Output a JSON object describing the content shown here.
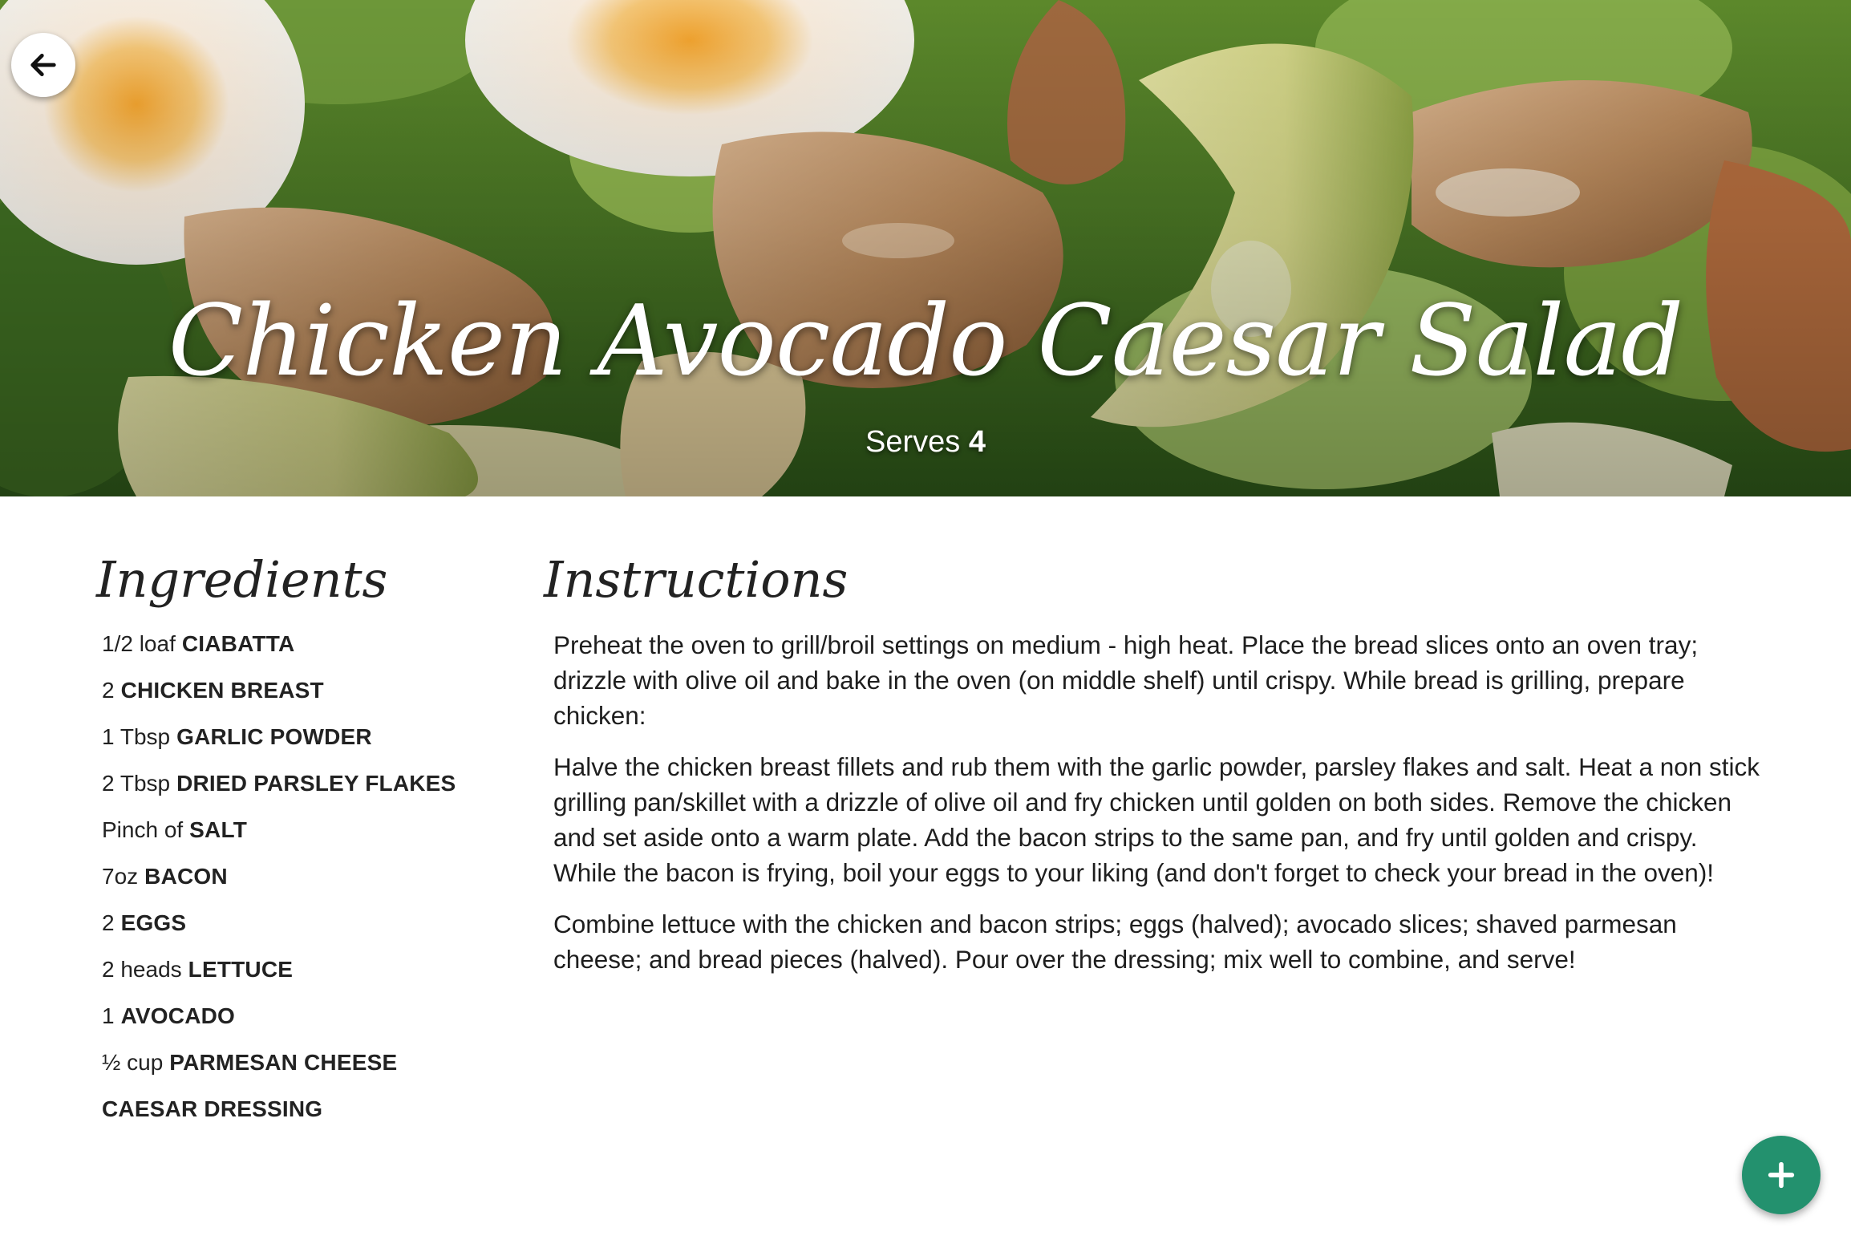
{
  "hero": {
    "title": "Chicken Avocado Caesar Salad",
    "serves_label": "Serves",
    "serves_count": "4",
    "back_icon": "arrow-left-icon"
  },
  "ingredients": {
    "heading": "Ingredients",
    "items": [
      {
        "qty": "1/2 loaf",
        "name": "CIABATTA"
      },
      {
        "qty": "2",
        "name": "CHICKEN BREAST"
      },
      {
        "qty": "1 Tbsp",
        "name": "GARLIC POWDER"
      },
      {
        "qty": "2 Tbsp",
        "name": "DRIED PARSLEY FLAKES"
      },
      {
        "qty": "Pinch of",
        "name": "SALT"
      },
      {
        "qty": "7oz",
        "name": "BACON"
      },
      {
        "qty": "2",
        "name": "EGGS"
      },
      {
        "qty": "2 heads",
        "name": "LETTUCE"
      },
      {
        "qty": "1",
        "name": "AVOCADO"
      },
      {
        "qty": "½ cup",
        "name": "PARMESAN CHEESE"
      },
      {
        "qty": "",
        "name": "CAESAR DRESSING"
      }
    ]
  },
  "instructions": {
    "heading": "Instructions",
    "steps": [
      "Preheat the oven to grill/broil settings on medium - high heat. Place the bread slices onto an oven tray; drizzle with olive oil and bake in the oven (on middle shelf) until crispy. While bread is grilling, prepare chicken:",
      "Halve the chicken breast fillets and rub them with the garlic powder, parsley flakes and salt. Heat a non stick grilling pan/skillet with a drizzle of olive oil and fry chicken until golden on both sides. Remove the chicken and set aside onto a warm plate. Add the bacon strips to the same pan, and fry until golden and crispy. While the bacon is frying, boil your eggs to your liking (and don't forget to check your bread in the oven)!",
      "Combine lettuce with the chicken and bacon strips; eggs (halved); avocado slices; shaved parmesan cheese; and bread pieces (halved). Pour over the dressing; mix well to combine, and serve!"
    ]
  },
  "fab": {
    "icon": "plus-icon",
    "color": "#23916e"
  },
  "colors": {
    "accent": "#23916e",
    "text": "#1e1e1e"
  }
}
